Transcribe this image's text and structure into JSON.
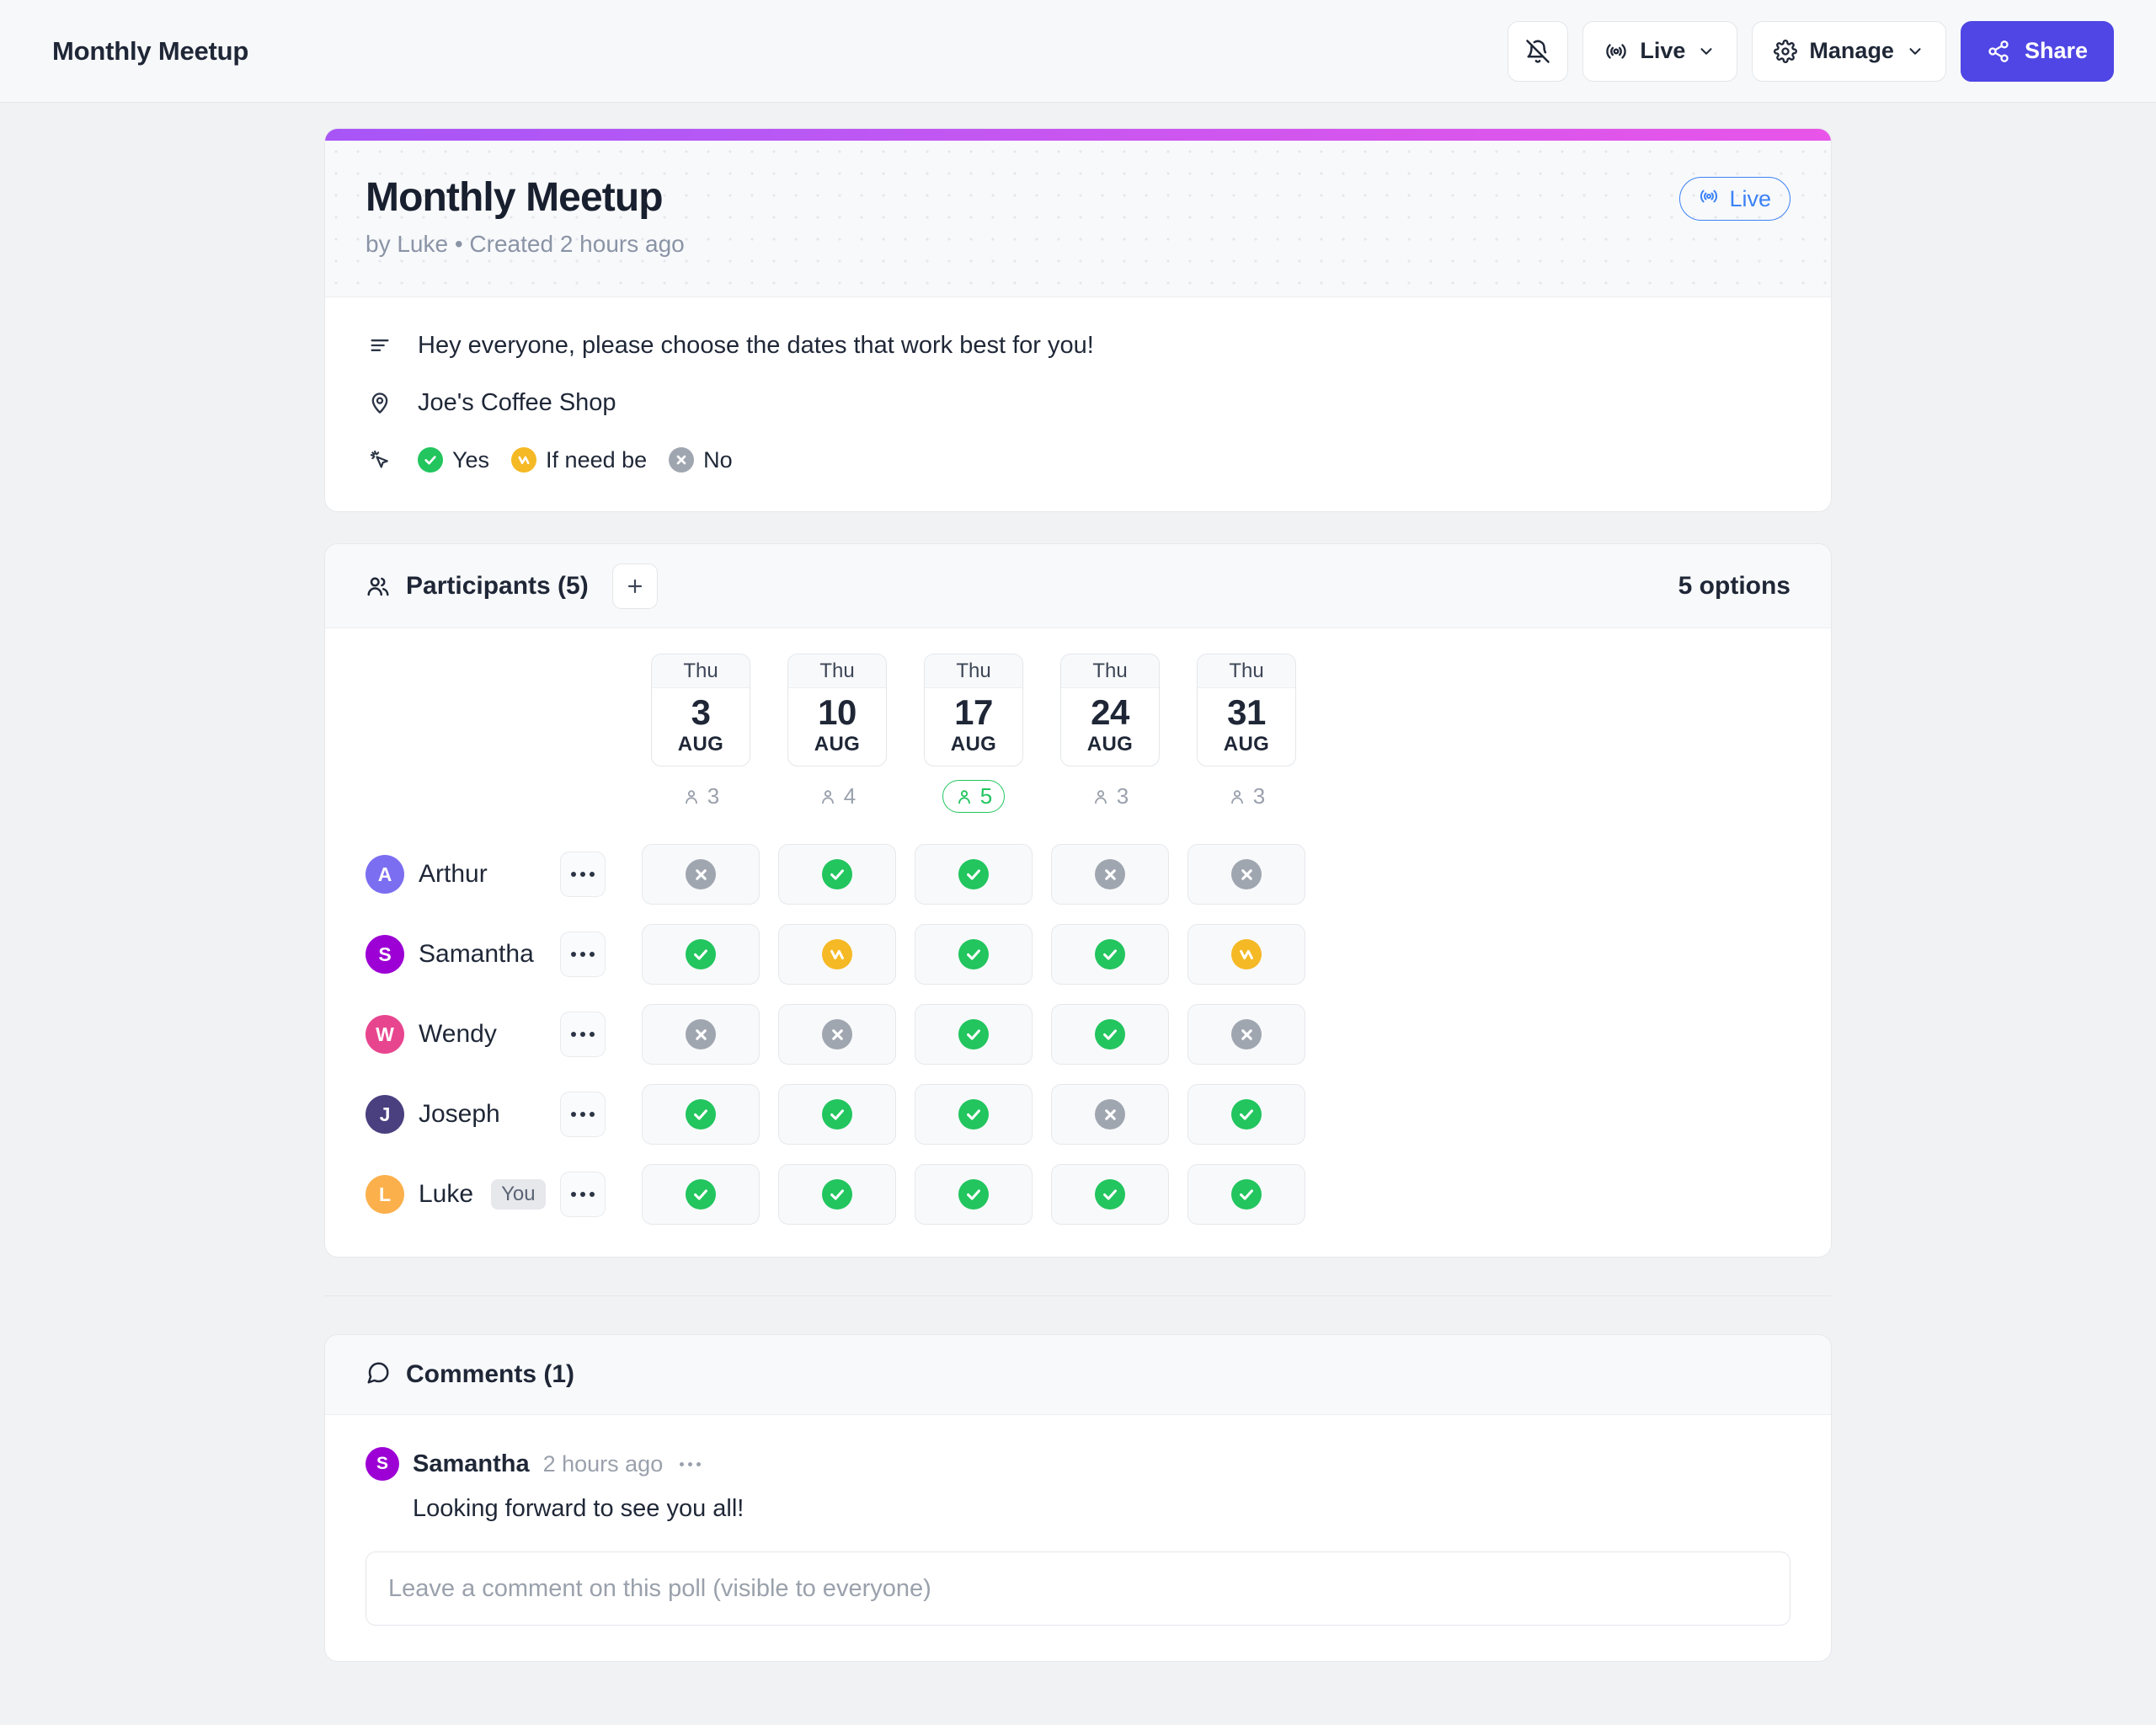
{
  "topbar": {
    "title": "Monthly Meetup",
    "notifications_icon": "bell-off-icon",
    "live_button": {
      "label": "Live",
      "icon": "broadcast-icon",
      "chevron": "chevron-down-icon"
    },
    "manage_button": {
      "label": "Manage",
      "icon": "gear-icon",
      "chevron": "chevron-down-icon"
    },
    "share_button": {
      "label": "Share",
      "icon": "share-icon",
      "color": "#4f46e5"
    }
  },
  "poll": {
    "gradient_from": "#a855f7",
    "gradient_to": "#e855e8",
    "title": "Monthly Meetup",
    "meta": "by Luke • Created 2 hours ago",
    "live_badge": {
      "label": "Live",
      "color": "#3b82f6"
    },
    "description": "Hey everyone, please choose the dates that work best for you!",
    "location": "Joe's Coffee Shop",
    "legend": [
      {
        "label": "Yes",
        "type": "yes",
        "color": "#22c55e"
      },
      {
        "label": "If need be",
        "type": "ifNeedBe",
        "color": "#f5b925"
      },
      {
        "label": "No",
        "type": "no",
        "color": "#a0a6b0"
      }
    ]
  },
  "participants_section": {
    "heading": "Participants (5)",
    "add_label": "+",
    "options_count": "5 options",
    "columns": [
      {
        "dow": "Thu",
        "day": "3",
        "month": "AUG",
        "count": "3",
        "best": false
      },
      {
        "dow": "Thu",
        "day": "10",
        "month": "AUG",
        "count": "4",
        "best": false
      },
      {
        "dow": "Thu",
        "day": "17",
        "month": "AUG",
        "count": "5",
        "best": true
      },
      {
        "dow": "Thu",
        "day": "24",
        "month": "AUG",
        "count": "3",
        "best": false
      },
      {
        "dow": "Thu",
        "day": "31",
        "month": "AUG",
        "count": "3",
        "best": false
      }
    ],
    "rows": [
      {
        "name": "Arthur",
        "initial": "A",
        "color": "#7c6ef0",
        "badge": "",
        "votes": [
          "no",
          "yes",
          "yes",
          "no",
          "no"
        ]
      },
      {
        "name": "Samantha",
        "initial": "S",
        "color": "#9c00d4",
        "badge": "",
        "votes": [
          "yes",
          "ifNeedBe",
          "yes",
          "yes",
          "ifNeedBe"
        ]
      },
      {
        "name": "Wendy",
        "initial": "W",
        "color": "#e8458f",
        "badge": "",
        "votes": [
          "no",
          "no",
          "yes",
          "yes",
          "no"
        ]
      },
      {
        "name": "Joseph",
        "initial": "J",
        "color": "#4a4080",
        "badge": "",
        "votes": [
          "yes",
          "yes",
          "yes",
          "no",
          "yes"
        ]
      },
      {
        "name": "Luke",
        "initial": "L",
        "color": "#fbb04c",
        "badge": "You",
        "votes": [
          "yes",
          "yes",
          "yes",
          "yes",
          "yes"
        ]
      }
    ]
  },
  "comments_section": {
    "heading": "Comments (1)",
    "comments": [
      {
        "author": "Samantha",
        "initial": "S",
        "color": "#9c00d4",
        "time": "2 hours ago",
        "text": "Looking forward to see you all!"
      }
    ],
    "input_placeholder": "Leave a comment on this poll (visible to everyone)",
    "input_value": ""
  }
}
